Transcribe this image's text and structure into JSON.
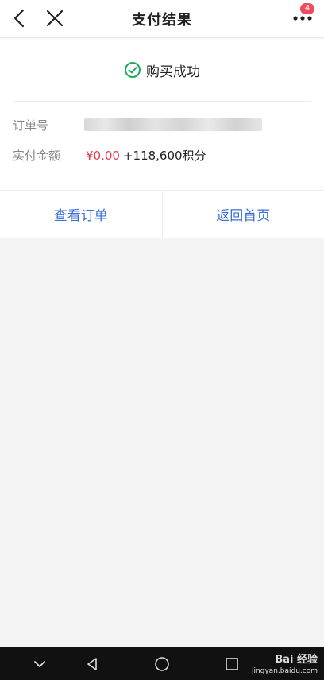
{
  "nav": {
    "title": "支付结果",
    "badge_count": "4",
    "icons": [
      "back-icon",
      "close-icon",
      "more-icon"
    ]
  },
  "result": {
    "status": "购买成功",
    "icon": "check-circle-icon"
  },
  "details": {
    "order_label": "订单号",
    "amount_label": "实付金额",
    "amount_money": "¥0.00",
    "amount_points": "+118,600积分"
  },
  "actions": {
    "view_order": "查看订单",
    "back_home": "返回首页"
  },
  "watermark": {
    "brand": "Bai 经验",
    "url": "jingyan.baidu.com"
  },
  "colors": {
    "accent": "#3a6fd6",
    "success": "#1aad5a",
    "price": "#e8354a",
    "badge": "#f04a5e"
  }
}
